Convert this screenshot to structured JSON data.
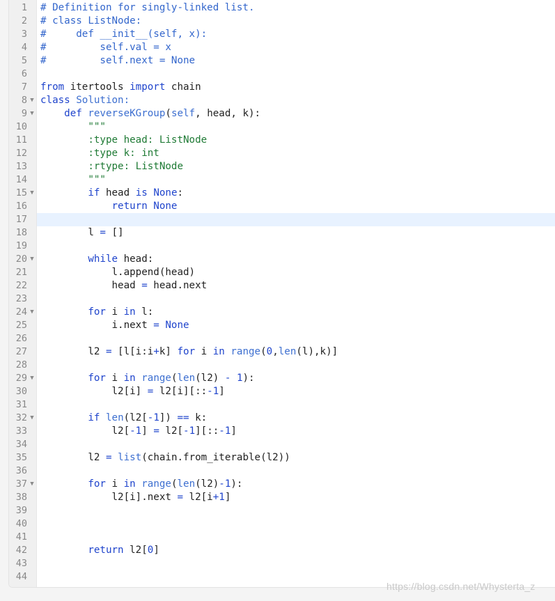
{
  "editor": {
    "colors": {
      "background": "#ffffff",
      "gutter": "#f0f0f0",
      "active_line": "#e8f2ff",
      "comment": "#3366cc",
      "keyword": "#1f44cc",
      "builtin": "#3d6fd0",
      "string": "#1f7a35",
      "text": "#222222"
    },
    "active_line": 17,
    "lines": [
      {
        "number": "1",
        "fold": false,
        "tokens": [
          {
            "t": "comment",
            "v": "# Definition for singly-linked list."
          }
        ]
      },
      {
        "number": "2",
        "fold": false,
        "tokens": [
          {
            "t": "comment",
            "v": "# class ListNode:"
          }
        ]
      },
      {
        "number": "3",
        "fold": false,
        "tokens": [
          {
            "t": "comment",
            "v": "#     def __init__(self, x):"
          }
        ]
      },
      {
        "number": "4",
        "fold": false,
        "tokens": [
          {
            "t": "comment",
            "v": "#         self.val = x"
          }
        ]
      },
      {
        "number": "5",
        "fold": false,
        "tokens": [
          {
            "t": "comment",
            "v": "#         self.next = None"
          }
        ]
      },
      {
        "number": "6",
        "fold": false,
        "tokens": []
      },
      {
        "number": "7",
        "fold": false,
        "tokens": [
          {
            "t": "keyword",
            "v": "from"
          },
          {
            "t": "text",
            "v": " itertools "
          },
          {
            "t": "keyword",
            "v": "import"
          },
          {
            "t": "text",
            "v": " chain"
          }
        ]
      },
      {
        "number": "8",
        "fold": true,
        "tokens": [
          {
            "t": "keyword",
            "v": "class"
          },
          {
            "t": "text",
            "v": " "
          },
          {
            "t": "builtin",
            "v": "Solution:"
          }
        ]
      },
      {
        "number": "9",
        "fold": true,
        "tokens": [
          {
            "t": "text",
            "v": "    "
          },
          {
            "t": "keyword",
            "v": "def"
          },
          {
            "t": "text",
            "v": " "
          },
          {
            "t": "builtin",
            "v": "reverseKGroup"
          },
          {
            "t": "text",
            "v": "("
          },
          {
            "t": "builtin",
            "v": "self"
          },
          {
            "t": "text",
            "v": ", head, k):"
          }
        ]
      },
      {
        "number": "10",
        "fold": false,
        "tokens": [
          {
            "t": "string",
            "v": "        \"\"\""
          }
        ]
      },
      {
        "number": "11",
        "fold": false,
        "tokens": [
          {
            "t": "string",
            "v": "        :type head: ListNode"
          }
        ]
      },
      {
        "number": "12",
        "fold": false,
        "tokens": [
          {
            "t": "string",
            "v": "        :type k: int"
          }
        ]
      },
      {
        "number": "13",
        "fold": false,
        "tokens": [
          {
            "t": "string",
            "v": "        :rtype: ListNode"
          }
        ]
      },
      {
        "number": "14",
        "fold": false,
        "tokens": [
          {
            "t": "string",
            "v": "        \"\"\""
          }
        ]
      },
      {
        "number": "15",
        "fold": true,
        "tokens": [
          {
            "t": "text",
            "v": "        "
          },
          {
            "t": "keyword",
            "v": "if"
          },
          {
            "t": "text",
            "v": " head "
          },
          {
            "t": "keyword",
            "v": "is"
          },
          {
            "t": "text",
            "v": " "
          },
          {
            "t": "keyword",
            "v": "None"
          },
          {
            "t": "text",
            "v": ":"
          }
        ]
      },
      {
        "number": "16",
        "fold": false,
        "tokens": [
          {
            "t": "text",
            "v": "            "
          },
          {
            "t": "keyword",
            "v": "return"
          },
          {
            "t": "text",
            "v": " "
          },
          {
            "t": "keyword",
            "v": "None"
          }
        ]
      },
      {
        "number": "17",
        "fold": false,
        "tokens": []
      },
      {
        "number": "18",
        "fold": false,
        "tokens": [
          {
            "t": "text",
            "v": "        l "
          },
          {
            "t": "operator",
            "v": "="
          },
          {
            "t": "text",
            "v": " []"
          }
        ]
      },
      {
        "number": "19",
        "fold": false,
        "tokens": []
      },
      {
        "number": "20",
        "fold": true,
        "tokens": [
          {
            "t": "text",
            "v": "        "
          },
          {
            "t": "keyword",
            "v": "while"
          },
          {
            "t": "text",
            "v": " head:"
          }
        ]
      },
      {
        "number": "21",
        "fold": false,
        "tokens": [
          {
            "t": "text",
            "v": "            l.append(head)"
          }
        ]
      },
      {
        "number": "22",
        "fold": false,
        "tokens": [
          {
            "t": "text",
            "v": "            head "
          },
          {
            "t": "operator",
            "v": "="
          },
          {
            "t": "text",
            "v": " head.next"
          }
        ]
      },
      {
        "number": "23",
        "fold": false,
        "tokens": []
      },
      {
        "number": "24",
        "fold": true,
        "tokens": [
          {
            "t": "text",
            "v": "        "
          },
          {
            "t": "keyword",
            "v": "for"
          },
          {
            "t": "text",
            "v": " i "
          },
          {
            "t": "keyword",
            "v": "in"
          },
          {
            "t": "text",
            "v": " l:"
          }
        ]
      },
      {
        "number": "25",
        "fold": false,
        "tokens": [
          {
            "t": "text",
            "v": "            i.next "
          },
          {
            "t": "operator",
            "v": "="
          },
          {
            "t": "text",
            "v": " "
          },
          {
            "t": "keyword",
            "v": "None"
          }
        ]
      },
      {
        "number": "26",
        "fold": false,
        "tokens": []
      },
      {
        "number": "27",
        "fold": false,
        "tokens": [
          {
            "t": "text",
            "v": "        l2 "
          },
          {
            "t": "operator",
            "v": "="
          },
          {
            "t": "text",
            "v": " [l[i:i"
          },
          {
            "t": "operator",
            "v": "+"
          },
          {
            "t": "text",
            "v": "k] "
          },
          {
            "t": "keyword",
            "v": "for"
          },
          {
            "t": "text",
            "v": " i "
          },
          {
            "t": "keyword",
            "v": "in"
          },
          {
            "t": "text",
            "v": " "
          },
          {
            "t": "builtin",
            "v": "range"
          },
          {
            "t": "text",
            "v": "("
          },
          {
            "t": "number",
            "v": "0"
          },
          {
            "t": "text",
            "v": ","
          },
          {
            "t": "builtin",
            "v": "len"
          },
          {
            "t": "text",
            "v": "(l),k)]"
          }
        ]
      },
      {
        "number": "28",
        "fold": false,
        "tokens": []
      },
      {
        "number": "29",
        "fold": true,
        "tokens": [
          {
            "t": "text",
            "v": "        "
          },
          {
            "t": "keyword",
            "v": "for"
          },
          {
            "t": "text",
            "v": " i "
          },
          {
            "t": "keyword",
            "v": "in"
          },
          {
            "t": "text",
            "v": " "
          },
          {
            "t": "builtin",
            "v": "range"
          },
          {
            "t": "text",
            "v": "("
          },
          {
            "t": "builtin",
            "v": "len"
          },
          {
            "t": "text",
            "v": "(l2) "
          },
          {
            "t": "operator",
            "v": "-"
          },
          {
            "t": "text",
            "v": " "
          },
          {
            "t": "number",
            "v": "1"
          },
          {
            "t": "text",
            "v": "):"
          }
        ]
      },
      {
        "number": "30",
        "fold": false,
        "tokens": [
          {
            "t": "text",
            "v": "            l2[i] "
          },
          {
            "t": "operator",
            "v": "="
          },
          {
            "t": "text",
            "v": " l2[i][::"
          },
          {
            "t": "operator",
            "v": "-"
          },
          {
            "t": "number",
            "v": "1"
          },
          {
            "t": "text",
            "v": "]"
          }
        ]
      },
      {
        "number": "31",
        "fold": false,
        "tokens": []
      },
      {
        "number": "32",
        "fold": true,
        "tokens": [
          {
            "t": "text",
            "v": "        "
          },
          {
            "t": "keyword",
            "v": "if"
          },
          {
            "t": "text",
            "v": " "
          },
          {
            "t": "builtin",
            "v": "len"
          },
          {
            "t": "text",
            "v": "(l2["
          },
          {
            "t": "operator",
            "v": "-"
          },
          {
            "t": "number",
            "v": "1"
          },
          {
            "t": "text",
            "v": "]) "
          },
          {
            "t": "operator",
            "v": "=="
          },
          {
            "t": "text",
            "v": " k:"
          }
        ]
      },
      {
        "number": "33",
        "fold": false,
        "tokens": [
          {
            "t": "text",
            "v": "            l2["
          },
          {
            "t": "operator",
            "v": "-"
          },
          {
            "t": "number",
            "v": "1"
          },
          {
            "t": "text",
            "v": "] "
          },
          {
            "t": "operator",
            "v": "="
          },
          {
            "t": "text",
            "v": " l2["
          },
          {
            "t": "operator",
            "v": "-"
          },
          {
            "t": "number",
            "v": "1"
          },
          {
            "t": "text",
            "v": "][::"
          },
          {
            "t": "operator",
            "v": "-"
          },
          {
            "t": "number",
            "v": "1"
          },
          {
            "t": "text",
            "v": "]"
          }
        ]
      },
      {
        "number": "34",
        "fold": false,
        "tokens": []
      },
      {
        "number": "35",
        "fold": false,
        "tokens": [
          {
            "t": "text",
            "v": "        l2 "
          },
          {
            "t": "operator",
            "v": "="
          },
          {
            "t": "text",
            "v": " "
          },
          {
            "t": "builtin",
            "v": "list"
          },
          {
            "t": "text",
            "v": "(chain.from_iterable(l2))"
          }
        ]
      },
      {
        "number": "36",
        "fold": false,
        "tokens": []
      },
      {
        "number": "37",
        "fold": true,
        "tokens": [
          {
            "t": "text",
            "v": "        "
          },
          {
            "t": "keyword",
            "v": "for"
          },
          {
            "t": "text",
            "v": " i "
          },
          {
            "t": "keyword",
            "v": "in"
          },
          {
            "t": "text",
            "v": " "
          },
          {
            "t": "builtin",
            "v": "range"
          },
          {
            "t": "text",
            "v": "("
          },
          {
            "t": "builtin",
            "v": "len"
          },
          {
            "t": "text",
            "v": "(l2)"
          },
          {
            "t": "operator",
            "v": "-"
          },
          {
            "t": "number",
            "v": "1"
          },
          {
            "t": "text",
            "v": "):"
          }
        ]
      },
      {
        "number": "38",
        "fold": false,
        "tokens": [
          {
            "t": "text",
            "v": "            l2[i].next "
          },
          {
            "t": "operator",
            "v": "="
          },
          {
            "t": "text",
            "v": " l2[i"
          },
          {
            "t": "operator",
            "v": "+"
          },
          {
            "t": "number",
            "v": "1"
          },
          {
            "t": "text",
            "v": "]"
          }
        ]
      },
      {
        "number": "39",
        "fold": false,
        "tokens": []
      },
      {
        "number": "40",
        "fold": false,
        "tokens": []
      },
      {
        "number": "41",
        "fold": false,
        "tokens": []
      },
      {
        "number": "42",
        "fold": false,
        "tokens": [
          {
            "t": "text",
            "v": "        "
          },
          {
            "t": "keyword",
            "v": "return"
          },
          {
            "t": "text",
            "v": " l2["
          },
          {
            "t": "number",
            "v": "0"
          },
          {
            "t": "text",
            "v": "]"
          }
        ]
      },
      {
        "number": "43",
        "fold": false,
        "tokens": []
      },
      {
        "number": "44",
        "fold": false,
        "tokens": []
      }
    ]
  },
  "watermark": {
    "text": "https://blog.csdn.net/Whysterta_z"
  }
}
